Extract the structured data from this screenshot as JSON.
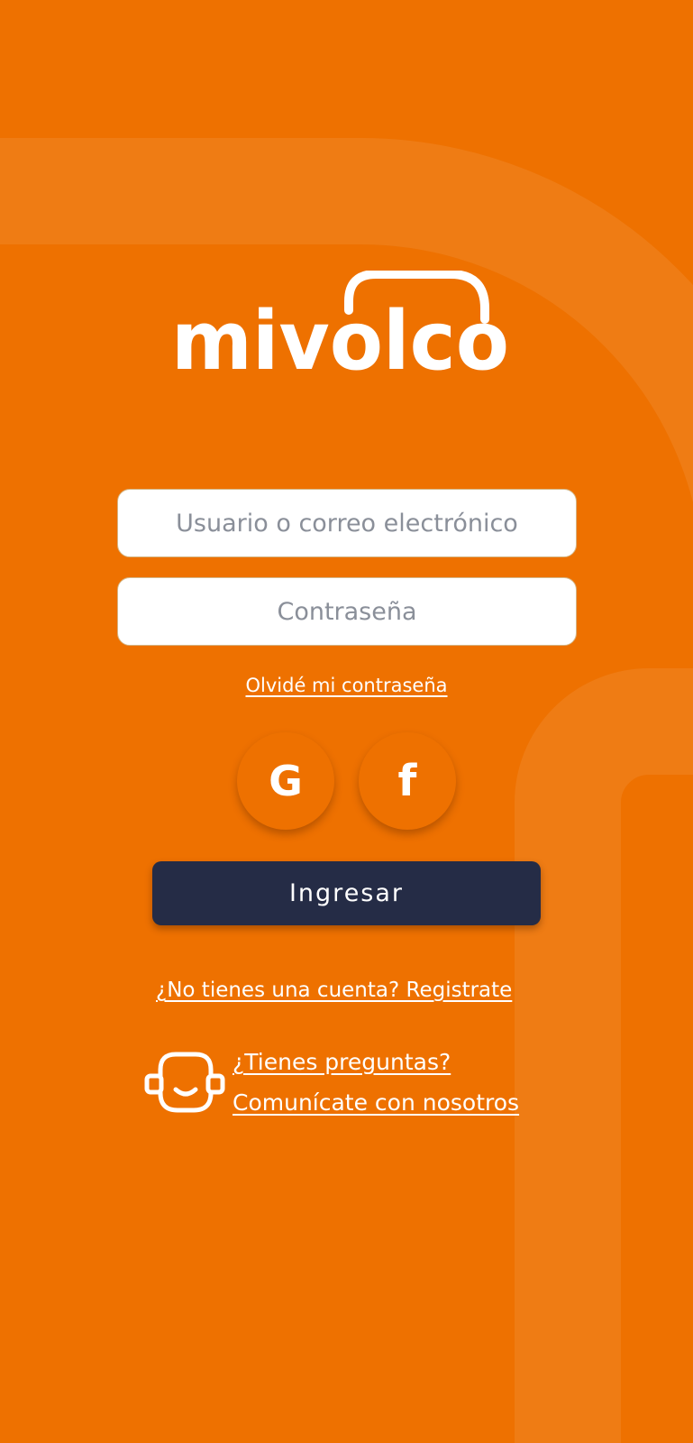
{
  "brand": {
    "logo_text": "mivolco",
    "background_color": "#ee7100",
    "button_color": "#252c46"
  },
  "login_form": {
    "username_placeholder": "Usuario o correo electrónico",
    "password_placeholder": "Contraseña",
    "forgot_password_label": "Olvidé mi contraseña",
    "submit_label": "Ingresar"
  },
  "social_login": [
    {
      "name": "google",
      "icon": "google-icon",
      "glyph": "G"
    },
    {
      "name": "facebook",
      "icon": "facebook-icon",
      "glyph": "f"
    }
  ],
  "register_link": "¿No tienes una cuenta? Registrate",
  "support": {
    "icon": "headset-smile-icon",
    "line1": "¿Tienes preguntas?",
    "line2": "Comunícate con nosotros"
  }
}
